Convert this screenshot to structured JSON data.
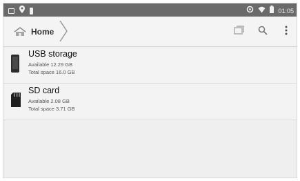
{
  "status_bar": {
    "time": "01:05",
    "icons_left": [
      "screenshot-icon",
      "location-icon",
      "usb-icon"
    ],
    "icons_right": [
      "sync-icon",
      "wifi-icon",
      "battery-icon"
    ]
  },
  "action_bar": {
    "breadcrumb": {
      "home_label": "Home"
    },
    "actions": [
      "bookmark-icon",
      "search-icon",
      "overflow-menu-icon"
    ]
  },
  "storage": [
    {
      "title": "USB storage",
      "available": "Available 12.29 GB",
      "total": "Total space 16.0 GB",
      "icon": "usb-storage-icon"
    },
    {
      "title": "SD card",
      "available": "Available 2.08 GB",
      "total": "Total space 3.71 GB",
      "icon": "sd-card-icon"
    }
  ],
  "colors": {
    "status_bar": "#6a6a6a",
    "background": "#efefef"
  }
}
